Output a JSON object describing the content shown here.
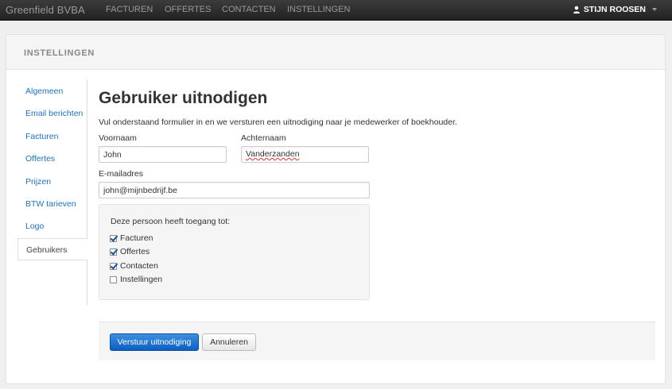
{
  "navbar": {
    "brand": "Greenfield BVBA",
    "items": [
      "FACTUREN",
      "OFFERTES",
      "CONTACTEN",
      "INSTELLINGEN"
    ],
    "user": "STIJN ROOSEN"
  },
  "panel": {
    "title": "INSTELLINGEN"
  },
  "sidebar": {
    "items": [
      {
        "label": "Algemeen"
      },
      {
        "label": "Email berichten"
      },
      {
        "label": "Facturen"
      },
      {
        "label": "Offertes"
      },
      {
        "label": "Prijzen"
      },
      {
        "label": "BTW tarieven"
      },
      {
        "label": "Logo"
      },
      {
        "label": "Gebruikers",
        "active": true
      }
    ]
  },
  "form": {
    "title": "Gebruiker uitnodigen",
    "intro": "Vul onderstaand formulier in en we versturen een uitnodiging naar je medewerker of boekhouder.",
    "firstname_label": "Voornaam",
    "firstname_value": "John",
    "lastname_label": "Achternaam",
    "lastname_value": "Vanderzanden",
    "email_label": "E-mailadres",
    "email_value": "john@mijnbedrijf.be",
    "access_title": "Deze persoon heeft toegang tot:",
    "access": [
      {
        "label": "Facturen",
        "checked": true
      },
      {
        "label": "Offertes",
        "checked": true
      },
      {
        "label": "Contacten",
        "checked": true
      },
      {
        "label": "Instellingen",
        "checked": false
      }
    ],
    "submit_label": "Verstuur uitnodiging",
    "cancel_label": "Annuleren"
  }
}
